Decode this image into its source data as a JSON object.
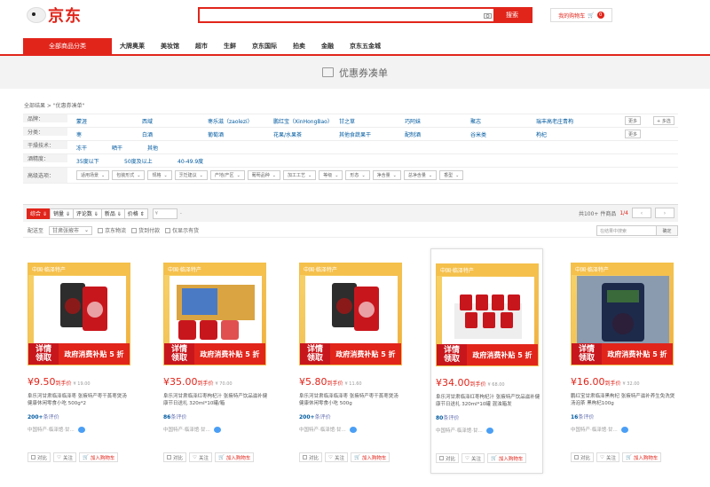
{
  "logo": "京东",
  "search": {
    "placeholder": "",
    "button": "搜索"
  },
  "cart": {
    "label": "我的购物车",
    "count": "0"
  },
  "nav": {
    "all": "全部商品分类",
    "items": [
      "大牌奥莱",
      "美妆馆",
      "超市",
      "生鲜",
      "京东国际",
      "拍卖",
      "金融",
      "京东五金城"
    ]
  },
  "banner": "优惠券凑单",
  "breadcrumb": "全部结果  >  \"优惠券凑单\"",
  "filters": {
    "brand": {
      "label": "品牌：",
      "vals": [
        "蒙涯",
        "西域",
        "枣乐滋（zaolezi）",
        "鹏红宝（XinHongBao）",
        "甘之草",
        "巧阿妹",
        "聚志",
        "瑞丰高老庄青枸"
      ]
    },
    "category": {
      "label": "分类：",
      "vals": [
        "枣",
        "白酒",
        "葡萄酒",
        "花果/水果茶",
        "其他食蔬果干",
        "配制酒",
        "谷米类",
        "枸杞"
      ]
    },
    "dry": {
      "label": "干燥技术：",
      "vals": [
        "冻干",
        "晒干",
        "其他"
      ]
    },
    "abv": {
      "label": "酒精度：",
      "vals": [
        "35度以下",
        "50度及以上",
        "40-49.9度"
      ]
    },
    "adv": {
      "label": "高级选项：",
      "vals": [
        "适用场景",
        "包装形式",
        "规格",
        "烹饪建议",
        "产地/产区",
        "葡萄品种",
        "加工工艺",
        "等级",
        "形态",
        "净含量",
        "总净含量",
        "香型"
      ]
    },
    "more": "更多",
    "multi": "+ 多选"
  },
  "sort": {
    "items": [
      "综合 ⇓",
      "销量 ⇓",
      "评论数 ⇓",
      "新品 ⇓",
      "价格 ⇕"
    ],
    "price_ph": "¥",
    "dash": "-",
    "total": "共100+ 件商品",
    "page": "1/4"
  },
  "opts": {
    "ship_label": "配送至",
    "ship_val": "甘肃张掖市",
    "jd": "京东物流",
    "cod": "货到付款",
    "instock": "仅显示有货",
    "search_ph": "在结果中搜索",
    "confirm": "确定"
  },
  "promo": {
    "tag": "中国·临泽特产",
    "l1": "详情",
    "l2": "领取",
    "r": "政府消费补贴 5 折"
  },
  "products": [
    {
      "price": "9.50",
      "note": "到手价",
      "orig": "¥ 19.00",
      "title": "阜乐河甘肃临泽临泽枣 张掖特产枣干蒸枣煲汤 健康休闲零食小吃 500g*2",
      "rev": "200+",
      "rev_l": "条评价",
      "shop": "中国特产·临泽馆·甘..."
    },
    {
      "price": "35.00",
      "note": "到手价",
      "orig": "¥ 70.00",
      "title": "阜乐河甘肃临泽红枣枸杞汁 张掖特产饮品滋补健康节日送礼 320ml*10罐/箱",
      "rev": "86",
      "rev_l": "条评价",
      "shop": "中国特产·临泽馆·甘..."
    },
    {
      "price": "5.80",
      "note": "到手价",
      "orig": "¥ 11.60",
      "title": "阜乐河甘肃临泽临泽枣 张掖特产枣干蒸枣煲汤 健康休闲零食小吃 500g",
      "rev": "200+",
      "rev_l": "条评价",
      "shop": "中国特产·临泽馆·甘..."
    },
    {
      "price": "34.00",
      "note": "到手价",
      "orig": "¥ 68.00",
      "title": "阜乐河甘肃临泽红枣枸杞汁 张掖特产饮品滋补健康节日送礼 320ml*10罐 混浊箱发",
      "rev": "80",
      "rev_l": "条评价",
      "shop": "中国特产·临泽馆·甘..."
    },
    {
      "price": "16.00",
      "note": "到手价",
      "orig": "¥ 32.00",
      "title": "鹏红宝甘肃临泽黑枸杞 张掖特产滋补养生免洗煲汤泡茶 黑枸杞100g",
      "rev": "16",
      "rev_l": "条评价",
      "shop": "中国特产·临泽馆·甘..."
    }
  ],
  "card_actions": {
    "compare": "对比",
    "follow": "关注",
    "add": "加入购物车"
  },
  "colors": {
    "accent": "#e1251b",
    "promo": "#f5c04b",
    "link": "#005aa0"
  }
}
